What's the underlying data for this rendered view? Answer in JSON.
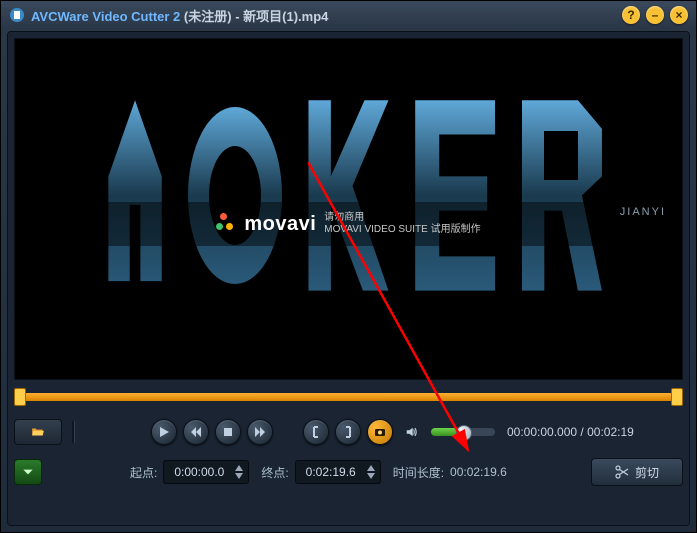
{
  "title": {
    "app": "AVCWare Video Cutter 2",
    "reg": "(未注册)",
    "sep": " - ",
    "file": "新项目(1).mp4"
  },
  "watermark": {
    "brand": "movavi",
    "sub1": "请勿商用",
    "sub2": "MOVAVI VIDEO SUITE 试用版制作",
    "corner": "JIANYI"
  },
  "winbtn": {
    "help": "?",
    "min": "–",
    "close": "×"
  },
  "volume": {
    "percent": 50
  },
  "time": {
    "current": "00:00:00.000",
    "sep": " / ",
    "total": "00:02:19"
  },
  "labels": {
    "start": "起点:",
    "end": "终点:",
    "duration_label": "时间长度:",
    "cut": "剪切"
  },
  "fields": {
    "start": "0:00:00.0",
    "end": "0:02:19.6",
    "duration": "00:02:19.6"
  }
}
